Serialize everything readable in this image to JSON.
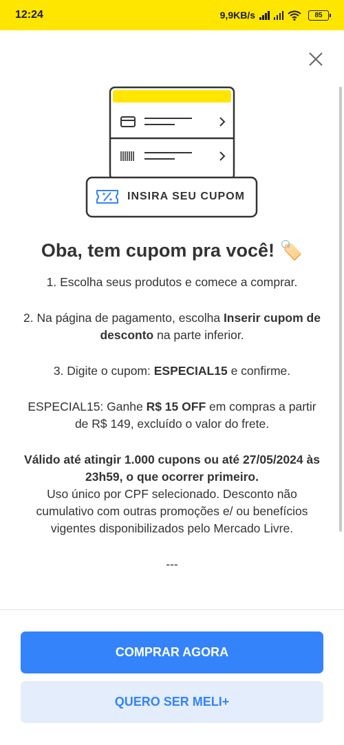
{
  "statusbar": {
    "time": "12:24",
    "network_speed": "9,9KB/s",
    "battery": "85"
  },
  "illustration": {
    "coupon_label": "INSIRA SEU CUPOM"
  },
  "title": "Oba, tem cupom pra você! 🏷️",
  "steps": {
    "step1": "1. Escolha seus produtos e comece a comprar.",
    "step2_pre": "2. Na página de pagamento, escolha ",
    "step2_bold": "Inserir cupom de desconto",
    "step2_post": " na parte inferior.",
    "step3_pre": "3. Digite o cupom: ",
    "step3_bold": "ESPECIAL15",
    "step3_post": " e confirme."
  },
  "offer": {
    "pre": "ESPECIAL15: Ganhe ",
    "bold": "R$ 15 OFF",
    "post": " em compras a partir de R$ 149, excluído o valor do frete."
  },
  "terms": {
    "bold": "Válido até atingir 1.000 cupons ou até 27/05/2024 às 23h59, o que ocorrer primeiro.",
    "regular": "Uso único por CPF selecionado. Desconto não cumulativo com outras promoções e/ ou benefícios vigentes disponibilizados pelo Mercado Livre."
  },
  "separator": "---",
  "buttons": {
    "primary": "COMPRAR AGORA",
    "secondary": "QUERO SER MELI+"
  },
  "colors": {
    "brand_yellow": "#ffe600",
    "primary_blue": "#3483fa",
    "secondary_bg": "#e3edfb"
  }
}
